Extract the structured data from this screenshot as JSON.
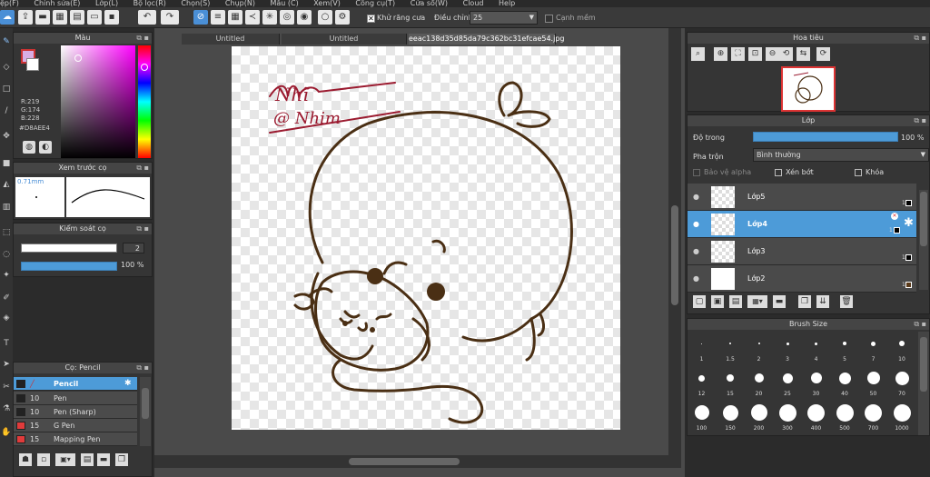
{
  "menu": [
    "ệp(F)",
    "Chỉnh sửa(E)",
    "Lớp(L)",
    "Bộ lọc(R)",
    "Chọn(S)",
    "Chụp(N)",
    "Mẫu (C)",
    "Xem(V)",
    "Công cụ(T)",
    "Cửa sổ(W)",
    "Cloud",
    "Help"
  ],
  "toolbar": {
    "antialias_label": "Khử răng cưa",
    "adjust_label": "Điều chỉnh",
    "adjust_value": "25",
    "smooth_label": "Cạnh mềm"
  },
  "color_panel": {
    "title": "Màu",
    "r": "R:219",
    "g": "G:174",
    "b": "B:228",
    "hex": "#D8AEE4",
    "fg_color": "#d8aee4"
  },
  "preview_panel": {
    "title": "Xem trước cọ",
    "size": "0.71mm"
  },
  "brush_control": {
    "title": "Kiểm soát cọ",
    "size": "2",
    "opacity": "100 %"
  },
  "brush_list": {
    "title": "Cọ: Pencil",
    "items": [
      {
        "size": "",
        "name": "Pencil"
      },
      {
        "size": "10",
        "name": "Pen"
      },
      {
        "size": "10",
        "name": "Pen (Sharp)"
      },
      {
        "size": "15",
        "name": "G Pen"
      },
      {
        "size": "15",
        "name": "Mapping Pen"
      }
    ]
  },
  "tabs": [
    "Untitled",
    "Untitled"
  ],
  "tooltip": "eeac138d35d85da79c362bc31efcae54.jpg",
  "canvas_text": {
    "sig1": "Nhĩ",
    "sig2": "@ Nhim"
  },
  "navigator": {
    "title": "Hoa tiêu"
  },
  "layer_panel": {
    "title": "Lớp",
    "opacity_label": "Độ trong",
    "opacity_value": "100 %",
    "opacity": 1.0,
    "blend_label": "Pha trộn",
    "blend_value": "Bình thường",
    "protect_alpha": "Bảo vệ alpha",
    "clip": "Xén bớt",
    "lock": "Khóa",
    "layers": [
      {
        "name": "Lớp5",
        "selected": false
      },
      {
        "name": "Lớp4",
        "selected": true
      },
      {
        "name": "Lớp3",
        "selected": false
      },
      {
        "name": "Lớp2",
        "selected": false
      }
    ]
  },
  "brush_size": {
    "title": "Brush Size",
    "sizes": [
      "1",
      "1.5",
      "2",
      "3",
      "4",
      "5",
      "7",
      "10",
      "12",
      "15",
      "20",
      "25",
      "30",
      "40",
      "50",
      "70",
      "100",
      "150",
      "200",
      "300",
      "400",
      "500",
      "700",
      "1000"
    ]
  }
}
